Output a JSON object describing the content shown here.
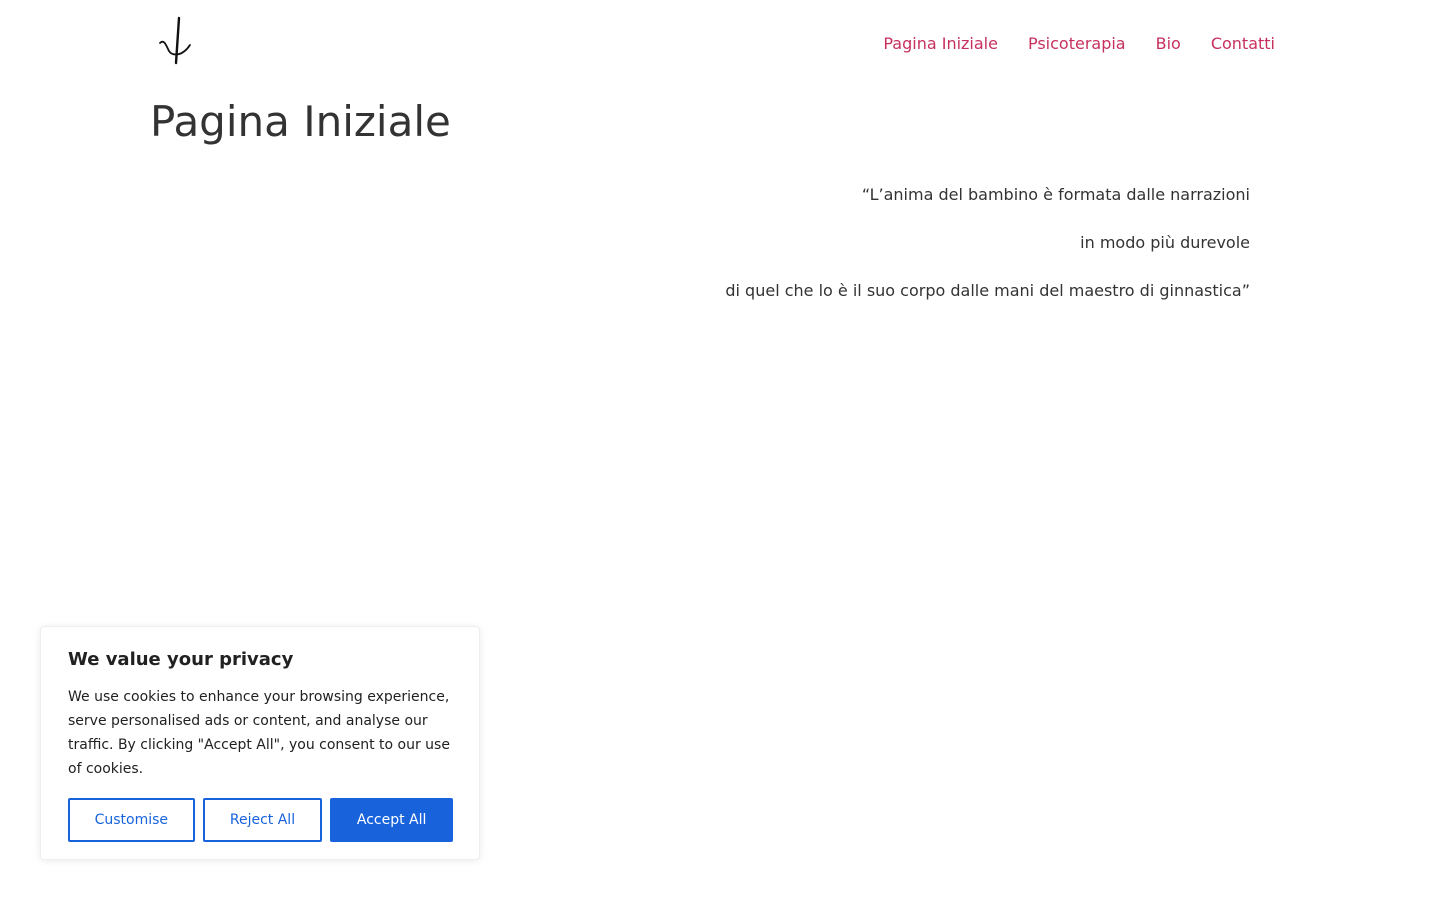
{
  "header": {
    "nav": [
      {
        "label": "Pagina Iniziale"
      },
      {
        "label": "Psicoterapia"
      },
      {
        "label": "Bio"
      },
      {
        "label": "Contatti"
      }
    ]
  },
  "main": {
    "title": "Pagina Iniziale",
    "quote_lines": [
      "“L’anima del bambino è formata dalle narrazioni",
      "in modo più durevole",
      "di quel che lo è il suo corpo dalle mani del maestro di ginnastica”"
    ]
  },
  "cookie_banner": {
    "title": "We value your privacy",
    "text": "We use cookies to enhance your browsing experience, serve personalised ads or content, and analyse our traffic. By clicking \"Accept All\", you consent to our use of cookies.",
    "customise_label": "Customise",
    "reject_label": "Reject All",
    "accept_label": "Accept All"
  },
  "colors": {
    "nav_link": "#c7305d",
    "accent_blue": "#1863dc",
    "text": "#333333"
  },
  "icons": {
    "logo": "psi-logo-icon"
  }
}
